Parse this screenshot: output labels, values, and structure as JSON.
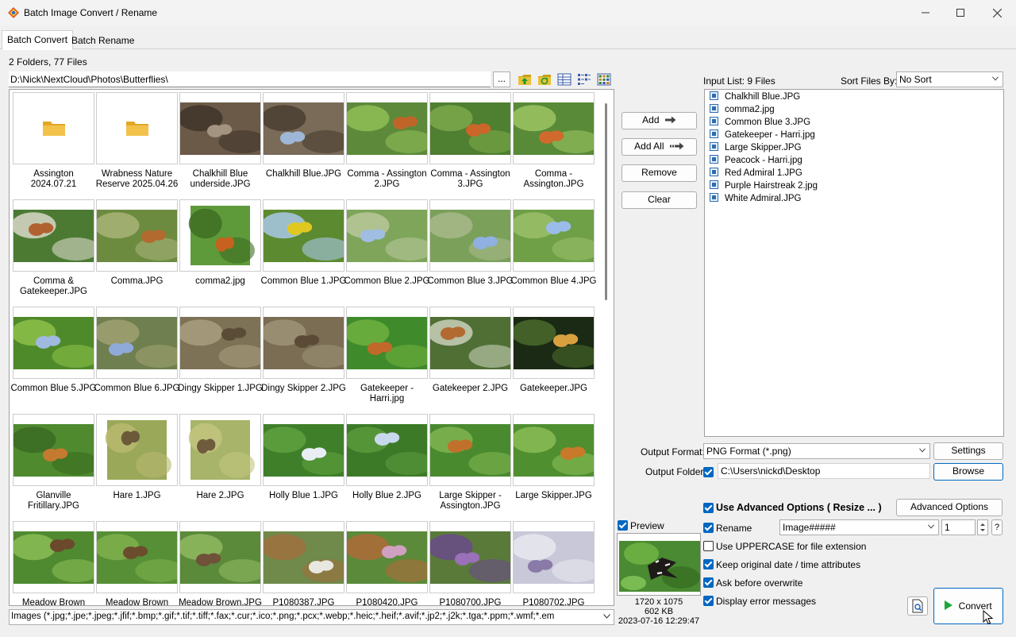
{
  "window": {
    "title": "Batch Image Convert / Rename",
    "controls": [
      "minimize",
      "maximize",
      "close"
    ]
  },
  "tabs": [
    {
      "label": "Batch Convert",
      "active": true
    },
    {
      "label": "Batch Rename",
      "active": false
    }
  ],
  "browser": {
    "counts": "2 Folders, 77 Files",
    "path": "D:\\Nick\\NextCloud\\Photos\\Butterflies\\",
    "browse_label": "...",
    "toolbar_icons": [
      "up-folder-icon",
      "refresh-icon",
      "details-view-icon",
      "list-view-icon",
      "thumbnail-view-icon"
    ],
    "items": [
      {
        "label": "Assington 2024.07.21",
        "type": "folder"
      },
      {
        "label": "Wrabness Nature Reserve 2025.04.26",
        "type": "folder"
      },
      {
        "label": "Chalkhill Blue underside.JPG",
        "type": "image",
        "palette": [
          "#6b5a48",
          "#a39482",
          "#3f342a"
        ]
      },
      {
        "label": "Chalkhill Blue.JPG",
        "type": "image",
        "palette": [
          "#7a6a58",
          "#9eb7d6",
          "#4a3e31"
        ]
      },
      {
        "label": "Comma - Assington 2.JPG",
        "type": "image",
        "palette": [
          "#5c8a3a",
          "#c0652a",
          "#8fbd55"
        ]
      },
      {
        "label": "Comma - Assington 3.JPG",
        "type": "image",
        "palette": [
          "#4f7f30",
          "#c96628",
          "#7ba84a"
        ]
      },
      {
        "label": "Comma - Assington.JPG",
        "type": "image",
        "palette": [
          "#588a38",
          "#cf6a2c",
          "#9cc463"
        ]
      },
      {
        "label": "Comma & Gatekeeper.JPG",
        "type": "image",
        "palette": [
          "#4c7a33",
          "#b06230",
          "#d8d8c8"
        ]
      },
      {
        "label": "Comma.JPG",
        "type": "image",
        "palette": [
          "#6c8b3f",
          "#b26a2f",
          "#a8b378"
        ]
      },
      {
        "label": "comma2.jpg",
        "type": "image",
        "palette": [
          "#5e9a3a",
          "#c7611f",
          "#3f6d22"
        ]
      },
      {
        "label": "Common Blue 1.JPG",
        "type": "image",
        "palette": [
          "#5c8a30",
          "#e0c820",
          "#a8c8e8"
        ]
      },
      {
        "label": "Common Blue 2.JPG",
        "type": "image",
        "palette": [
          "#7ea55a",
          "#a0bde2",
          "#b7c79a"
        ]
      },
      {
        "label": "Common Blue 3.JPG",
        "type": "image",
        "palette": [
          "#7aa05a",
          "#8fb0e0",
          "#a7b98a"
        ]
      },
      {
        "label": "Common Blue 4.JPG",
        "type": "image",
        "palette": [
          "#6f9f47",
          "#9bbce8",
          "#9bc06a"
        ]
      },
      {
        "label": "Common Blue 5.JPG",
        "type": "image",
        "palette": [
          "#4f8a2a",
          "#9fb9e0",
          "#8cbf4a"
        ]
      },
      {
        "label": "Common Blue 6.JPG",
        "type": "image",
        "palette": [
          "#6f7f4f",
          "#8fa9d8",
          "#a0a070"
        ]
      },
      {
        "label": "Dingy Skipper 1.JPG",
        "type": "image",
        "palette": [
          "#7d7156",
          "#5b4c38",
          "#a89d7e"
        ]
      },
      {
        "label": "Dingy Skipper 2.JPG",
        "type": "image",
        "palette": [
          "#7a6d54",
          "#5a4a36",
          "#9d9375"
        ]
      },
      {
        "label": "Gatekeeper - Harri.jpg",
        "type": "image",
        "palette": [
          "#3f8a2a",
          "#c0692a",
          "#6fb040"
        ]
      },
      {
        "label": "Gatekeeper 2.JPG",
        "type": "image",
        "palette": [
          "#4f6f35",
          "#b26a30",
          "#c8d0b8"
        ]
      },
      {
        "label": "Gatekeeper.JPG",
        "type": "image",
        "palette": [
          "#1a2a14",
          "#d9a040",
          "#4a6a2a"
        ]
      },
      {
        "label": "Glanville Fritillary.JPG",
        "type": "image",
        "palette": [
          "#4f8a2f",
          "#c47a30",
          "#3a6a22"
        ]
      },
      {
        "label": "Hare 1.JPG",
        "type": "image",
        "palette": [
          "#9aa85a",
          "#6b5a3a",
          "#b8b870"
        ]
      },
      {
        "label": "Hare 2.JPG",
        "type": "image",
        "palette": [
          "#a8b46a",
          "#6e5c3c",
          "#c2c47e"
        ]
      },
      {
        "label": "Holly Blue 1.JPG",
        "type": "image",
        "palette": [
          "#3f7f2a",
          "#e8eef4",
          "#5fa040"
        ]
      },
      {
        "label": "Holly Blue 2.JPG",
        "type": "image",
        "palette": [
          "#3d7a28",
          "#c8d8ec",
          "#5a9a3a"
        ]
      },
      {
        "label": "Large Skipper - Assington.JPG",
        "type": "image",
        "palette": [
          "#4a8a2f",
          "#c0702a",
          "#7fb450"
        ]
      },
      {
        "label": "Large Skipper.JPG",
        "type": "image",
        "palette": [
          "#4f8f30",
          "#c87a2a",
          "#8abc55"
        ]
      },
      {
        "label": "Meadow Brown",
        "type": "image",
        "palette": [
          "#4f8a30",
          "#6a4a2a",
          "#8abc55"
        ]
      },
      {
        "label": "Meadow Brown",
        "type": "image",
        "palette": [
          "#568f36",
          "#6b4d2e",
          "#7fb04c"
        ]
      },
      {
        "label": "Meadow Brown.JPG",
        "type": "image",
        "palette": [
          "#5a8a3a",
          "#70523a",
          "#90b860"
        ]
      },
      {
        "label": "P1080387.JPG",
        "type": "image",
        "palette": [
          "#6f8a4a",
          "#e8e8e0",
          "#a07040"
        ]
      },
      {
        "label": "P1080420.JPG",
        "type": "image",
        "palette": [
          "#5a8a3a",
          "#d0a0c0",
          "#b06a3a"
        ]
      },
      {
        "label": "P1080700.JPG",
        "type": "image",
        "palette": [
          "#5a7a3a",
          "#9a70b8",
          "#6a4a8a"
        ]
      },
      {
        "label": "P1080702.JPG",
        "type": "image",
        "palette": [
          "#c8c8d8",
          "#8a7aa8",
          "#e8e8f0"
        ]
      }
    ],
    "filter": "Images (*.jpg;*.jpe;*.jpeg;*.jfif;*.bmp;*.gif;*.tif;*.tiff;*.fax;*.cur;*.ico;*.png;*.pcx;*.webp;*.heic;*.heif;*.avif;*.jp2;*.j2k;*.tga;*.ppm;*.wmf;*.em"
  },
  "transfer_buttons": {
    "add": "Add",
    "add_all": "Add All",
    "remove": "Remove",
    "clear": "Clear"
  },
  "preview": {
    "label": "Preview",
    "checked": true,
    "dimensions": "1720 x 1075",
    "size": "602 KB",
    "date": "2023-07-16 12:29:47"
  },
  "input_list": {
    "label": "Input List:  9 Files",
    "sort_label": "Sort Files By:",
    "sort_value": "No Sort",
    "files": [
      "Chalkhill Blue.JPG",
      "comma2.jpg",
      "Common Blue 3.JPG",
      "Gatekeeper - Harri.jpg",
      "Large Skipper.JPG",
      "Peacock - Harri.jpg",
      "Red Admiral 1.JPG",
      "Purple Hairstreak 2.jpg",
      "White Admiral.JPG"
    ]
  },
  "output": {
    "format_label": "Output Format:",
    "format_value": "PNG Format (*.png)",
    "settings_label": "Settings",
    "folder_label": "Output Folder:",
    "folder_checked": true,
    "folder_value": "C:\\Users\\nickd\\Desktop",
    "browse_label": "Browse"
  },
  "options": {
    "advanced_label": "Use Advanced Options ( Resize ... )",
    "advanced_checked": true,
    "advanced_button": "Advanced Options",
    "rename_label": "Rename",
    "rename_checked": true,
    "rename_pattern": "Image#####",
    "rename_start": "1",
    "help_label": "?",
    "uppercase_label": "Use UPPERCASE for file extension",
    "uppercase_checked": false,
    "keep_date_label": "Keep original date / time attributes",
    "keep_date_checked": true,
    "ask_overwrite_label": "Ask before overwrite",
    "ask_overwrite_checked": true,
    "display_errors_label": "Display error messages",
    "display_errors_checked": true
  },
  "actions": {
    "convert_label": "Convert"
  },
  "colors": {
    "accent": "#0067c0",
    "folder": "#f2c24b",
    "play": "#1fa83a"
  }
}
